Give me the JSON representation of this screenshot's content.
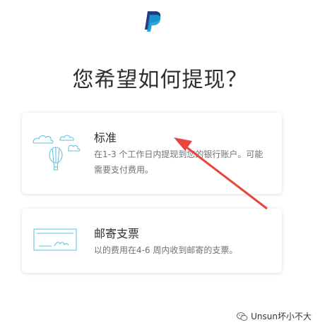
{
  "page": {
    "title": "您希望如何提现？"
  },
  "options": {
    "standard": {
      "title": "标准",
      "description": "在1-3 个工作日内提现到您的银行账户。可能需要支付费用。",
      "icon": "balloon-clouds-icon"
    },
    "mail_check": {
      "title": "邮寄支票",
      "description": "以的费用在4-6 周内收到邮寄的支票。",
      "icon": "check-icon"
    }
  },
  "watermark": {
    "text": "Unsun坏小不大",
    "icon": "wechat-icon"
  },
  "colors": {
    "paypal_dark": "#253b80",
    "paypal_light": "#179bd7",
    "icon_line": "#5bc0de",
    "annotation_arrow": "#e8453c"
  }
}
